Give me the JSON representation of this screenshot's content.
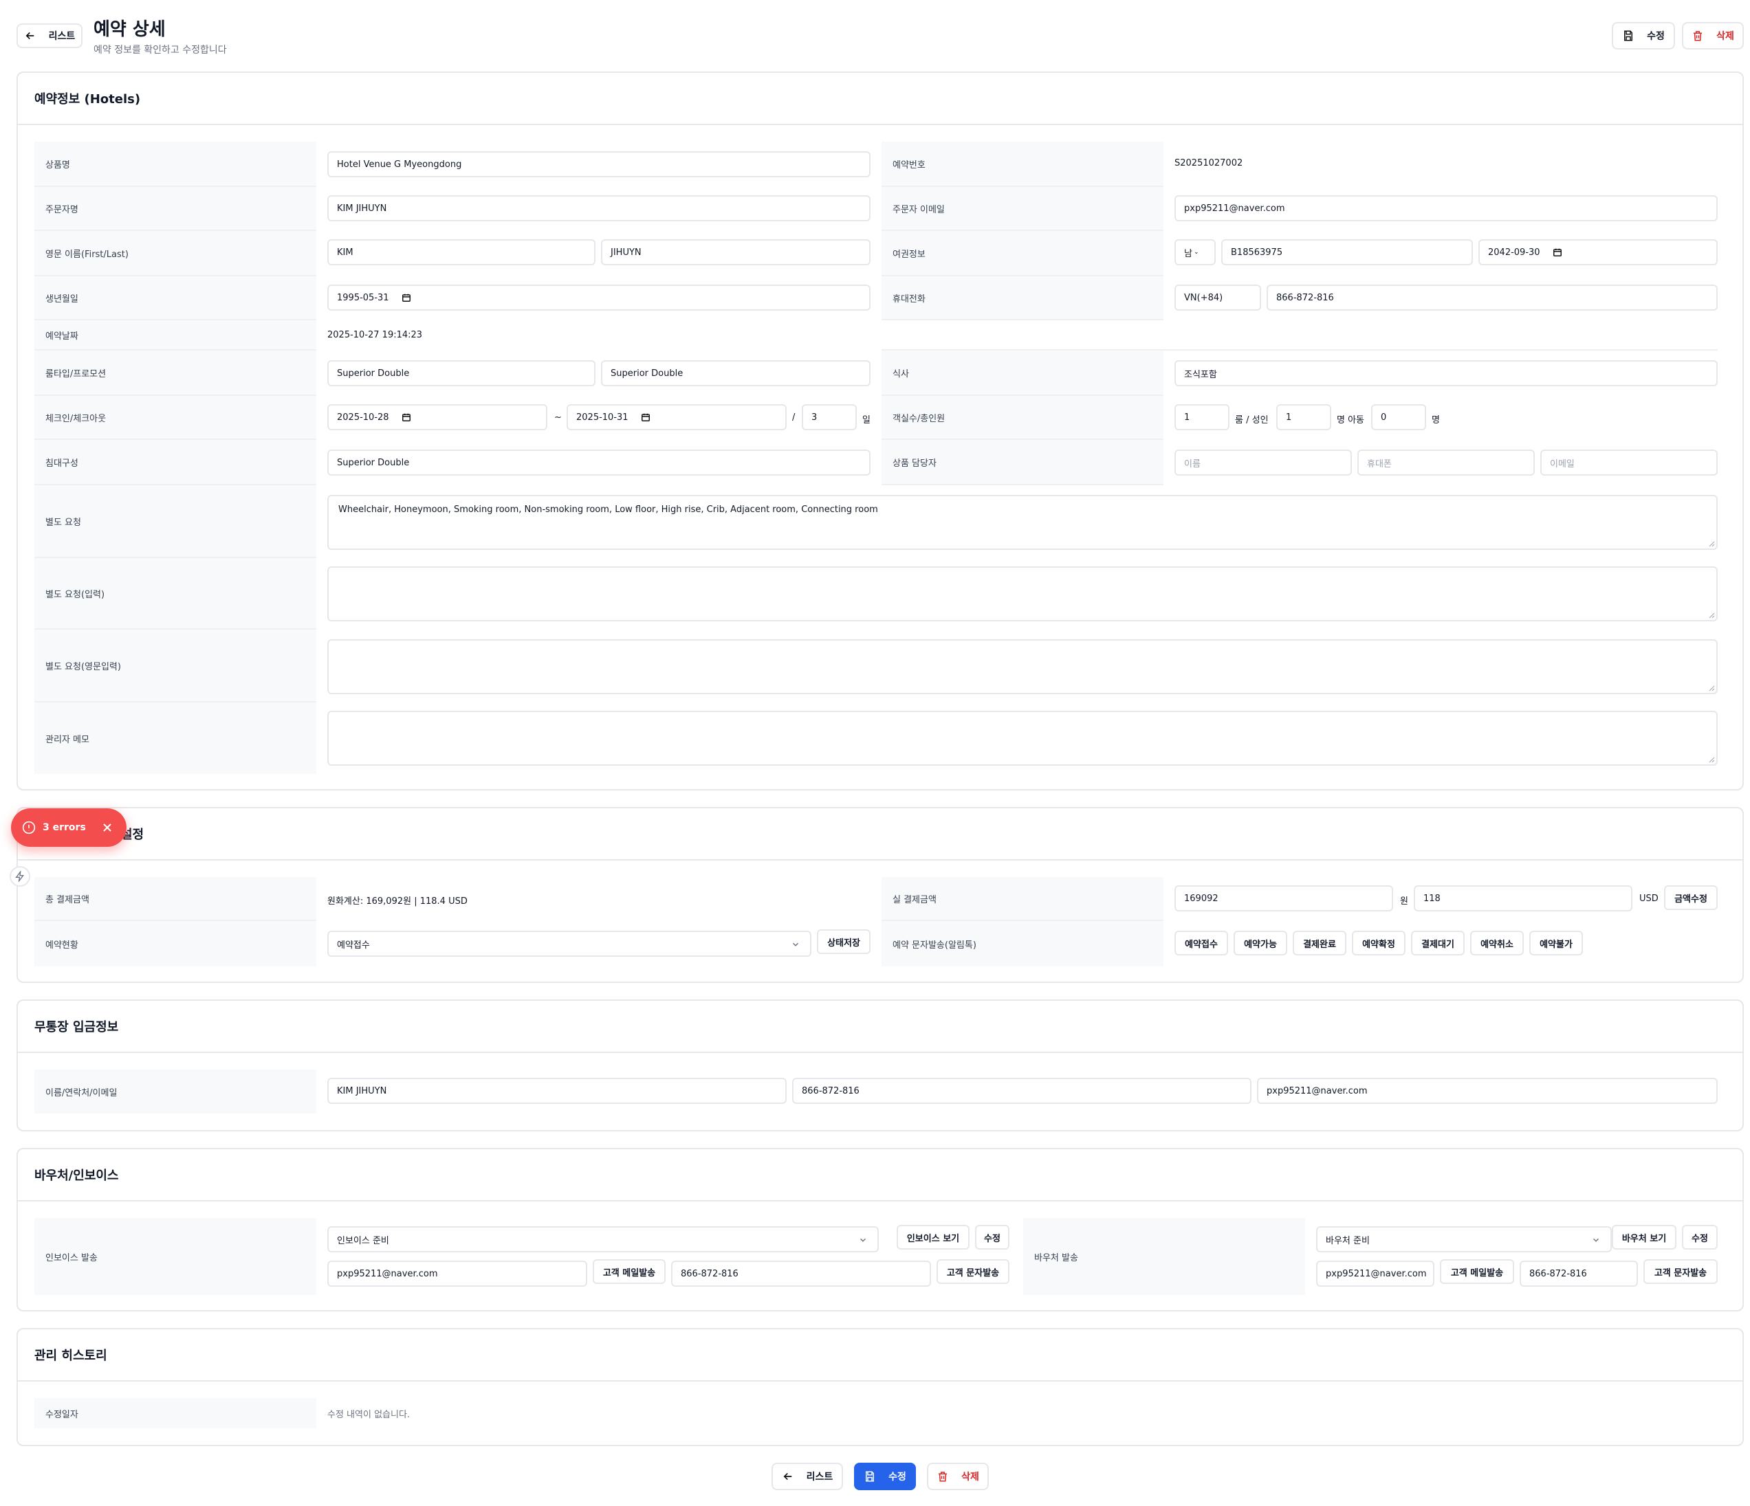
{
  "header": {
    "back_label": "리스트",
    "title": "예약 상세",
    "subtitle": "예약 정보를 확인하고 수정합니다",
    "edit_label": "수정",
    "delete_label": "삭제"
  },
  "reservation": {
    "section_title": "예약정보 (Hotels)",
    "product_name_label": "상품명",
    "product_name": "Hotel Venue G Myeongdong",
    "booking_no_label": "예약번호",
    "booking_no": "S20251027002",
    "orderer_label": "주문자명",
    "orderer": "KIM JIHUYN",
    "orderer_email_label": "주문자 이메일",
    "orderer_email": "pxp95211@naver.com",
    "eng_name_label": "영문 이름(First/Last)",
    "first_name": "KIM",
    "last_name": "JIHUYN",
    "passport_label": "여권정보",
    "passport_gender": "남",
    "passport_no": "B18563975",
    "passport_expiry": "2042-09-30",
    "birth_label": "생년월일",
    "birth": "1995-05-31",
    "phone_label": "휴대전화",
    "phone_country": "VN(+84)",
    "phone": "866-872-816",
    "booking_date_label": "예약날짜",
    "booking_date": "2025-10-27 19:14:23",
    "room_label": "룸타입/프로모션",
    "room_type": "Superior Double",
    "promotion": "Superior Double",
    "meal_label": "식사",
    "meal": "조식포함",
    "checkin_label": "체크인/체크아웃",
    "checkin": "2025-10-28",
    "tilde": "~",
    "checkout": "2025-10-31",
    "slash": "/",
    "nights": "3",
    "nights_unit": "일",
    "rooms_label": "객실수/총인원",
    "rooms": "1",
    "rooms_unit": "룸 / 성인",
    "adults": "1",
    "adults_unit": "명 아동",
    "children": "0",
    "children_unit": "명",
    "bed_label": "침대구성",
    "bed": "Superior Double",
    "manager_label": "상품 담당자",
    "manager_name_ph": "이름",
    "manager_phone_ph": "휴대폰",
    "manager_email_ph": "이메일",
    "request_label": "별도 요청",
    "request": "Wheelchair, Honeymoon, Smoking room, Non-smoking room, Low floor, High rise, Crib, Adjacent room, Connecting room",
    "request_input_label": "별도 요청(입력)",
    "request_eng_label": "별도 요청(영문입력)",
    "admin_memo_label": "관리자 메모"
  },
  "status": {
    "section_title_visible": "설정",
    "total_label": "총 결제금액",
    "total_value": "원화계산: 169,092원 | 118.4 USD",
    "actual_label": "실 결제금액",
    "actual_krw": "169092",
    "krw_unit": "원",
    "actual_usd": "118",
    "usd_unit": "USD",
    "amount_edit_label": "금액수정",
    "state_label": "예약현황",
    "state_value": "예약접수",
    "state_save_label": "상태저장",
    "sms_label": "예약 문자발송(알림톡)",
    "sms_buttons": [
      "예약접수",
      "예약가능",
      "결제완료",
      "예약확정",
      "결제대기",
      "예약취소",
      "예약불가"
    ]
  },
  "deposit": {
    "section_title": "무통장 입금정보",
    "label": "이름/연락처/이메일",
    "name": "KIM JIHUYN",
    "phone": "866-872-816",
    "email": "pxp95211@naver.com"
  },
  "voucher": {
    "section_title": "바우처/인보이스",
    "invoice_label": "인보이스 발송",
    "invoice_status": "인보이스 준비",
    "invoice_view": "인보이스 보기",
    "invoice_edit": "수정",
    "invoice_email": "pxp95211@naver.com",
    "invoice_mail_btn": "고객 메일발송",
    "invoice_phone": "866-872-816",
    "invoice_sms_btn": "고객 문자발송",
    "voucher_label": "바우처 발송",
    "voucher_status": "바우처 준비",
    "voucher_view": "바우처 보기",
    "voucher_edit": "수정",
    "voucher_email": "pxp95211@naver.com",
    "voucher_mail_btn": "고객 메일발송",
    "voucher_phone": "866-872-816",
    "voucher_sms_btn": "고객 문자발송"
  },
  "history": {
    "section_title": "관리 히스토리",
    "label": "수정일자",
    "empty": "수정 내역이 없습니다."
  },
  "toast": {
    "text": "3 errors"
  },
  "footer": {
    "back_label": "리스트",
    "edit_label": "수정",
    "delete_label": "삭제"
  },
  "colors": {
    "primary": "#2563eb",
    "danger": "#dc2626",
    "toast": "#f44d4d",
    "label_bg": "#f8f9fa",
    "border": "#e5e7eb"
  }
}
